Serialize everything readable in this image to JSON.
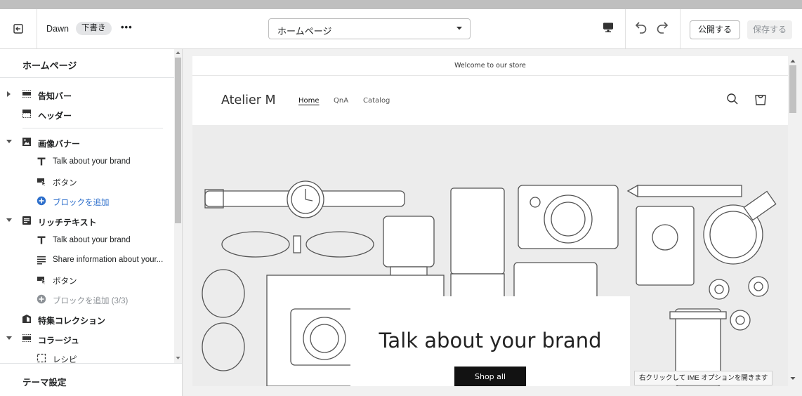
{
  "topbar": {
    "theme_name": "Dawn",
    "draft_badge": "下書き",
    "more_label": "•••",
    "page_select_value": "ホームページ",
    "publish_label": "公開する",
    "save_label": "保存する"
  },
  "sidebar": {
    "title": "ホームページ",
    "items": [
      {
        "label": "告知バー",
        "icon": "announcement-bar-icon"
      },
      {
        "label": "ヘッダー",
        "icon": "header-icon"
      },
      {
        "label": "画像バナー",
        "icon": "image-banner-icon"
      },
      {
        "label": "Talk about your brand",
        "icon": "text-block-icon"
      },
      {
        "label": "ボタン",
        "icon": "button-block-icon"
      },
      {
        "label": "ブロックを追加",
        "icon": "plus-circle-icon"
      },
      {
        "label": "リッチテキスト",
        "icon": "rich-text-icon"
      },
      {
        "label": "Talk about your brand",
        "icon": "text-block-icon"
      },
      {
        "label": "Share information about your...",
        "icon": "paragraph-icon"
      },
      {
        "label": "ボタン",
        "icon": "button-block-icon"
      },
      {
        "label": "ブロックを追加 (3/3)",
        "icon": "plus-circle-icon"
      },
      {
        "label": "特集コレクション",
        "icon": "collection-icon"
      },
      {
        "label": "コラージュ",
        "icon": "collage-icon"
      },
      {
        "label": "レシピ",
        "icon": "recipe-icon"
      }
    ],
    "footer_label": "テーマ設定"
  },
  "preview": {
    "announcement": "Welcome to our store",
    "store_name": "Atelier M",
    "nav": [
      "Home",
      "QnA",
      "Catalog"
    ],
    "banner_heading": "Talk about your brand",
    "shop_all_label": "Shop all"
  },
  "ime_tooltip": "右クリックして IME オプションを開きます",
  "colors": {
    "accent_blue": "#2c6ecb",
    "button_dark": "#121212",
    "banner_bg": "#ececec"
  }
}
